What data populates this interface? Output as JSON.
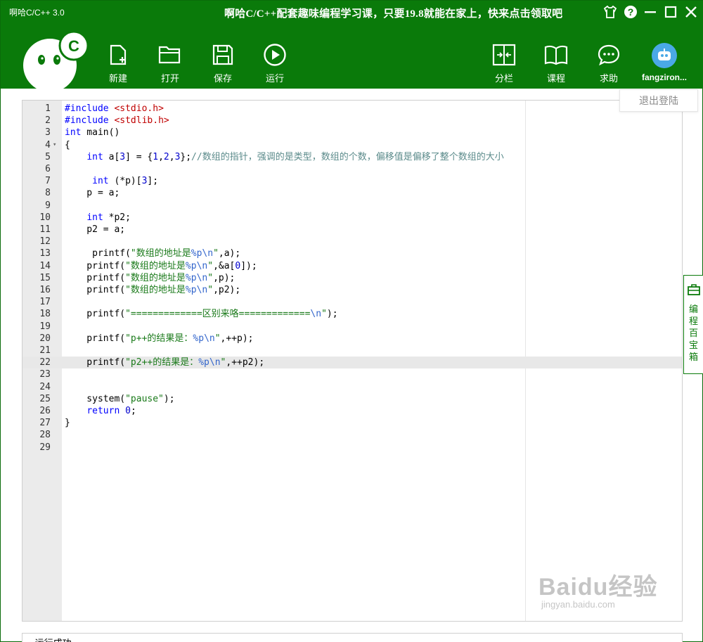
{
  "window": {
    "title": "啊哈C/C++ 3.0",
    "promo": "啊哈C/C++配套趣味编程学习课，只要19.8就能在家上，快来点击领取吧"
  },
  "toolbar": {
    "new": "新建",
    "open": "打开",
    "save": "保存",
    "run": "运行",
    "split": "分栏",
    "course": "课程",
    "help": "求助"
  },
  "user": {
    "name": "fangziron...",
    "logout": "退出登陆"
  },
  "side_panel": {
    "label": "编程百宝箱"
  },
  "editor": {
    "active_line": 22,
    "lines": [
      {
        "n": "1",
        "fold": "",
        "code": "#include <stdio.h>"
      },
      {
        "n": "2",
        "fold": "",
        "code": "#include <stdlib.h>"
      },
      {
        "n": "3",
        "fold": "",
        "code": "int main()"
      },
      {
        "n": "4",
        "fold": "▾",
        "code": "{"
      },
      {
        "n": "5",
        "fold": "",
        "code": "    int a[3] = {1,2,3};//数组的指针，强调的是类型，数组的个数，偏移值是偏移了整个数组的大小"
      },
      {
        "n": "6",
        "fold": "",
        "code": ""
      },
      {
        "n": "7",
        "fold": "",
        "code": "     int (*p)[3];"
      },
      {
        "n": "8",
        "fold": "",
        "code": "    p = a;"
      },
      {
        "n": "9",
        "fold": "",
        "code": ""
      },
      {
        "n": "10",
        "fold": "",
        "code": "    int *p2;"
      },
      {
        "n": "11",
        "fold": "",
        "code": "    p2 = a;"
      },
      {
        "n": "12",
        "fold": "",
        "code": ""
      },
      {
        "n": "13",
        "fold": "",
        "code": "     printf(\"数组的地址是%p\\n\",a);"
      },
      {
        "n": "14",
        "fold": "",
        "code": "    printf(\"数组的地址是%p\\n\",&a[0]);"
      },
      {
        "n": "15",
        "fold": "",
        "code": "    printf(\"数组的地址是%p\\n\",p);"
      },
      {
        "n": "16",
        "fold": "",
        "code": "    printf(\"数组的地址是%p\\n\",p2);"
      },
      {
        "n": "17",
        "fold": "",
        "code": ""
      },
      {
        "n": "18",
        "fold": "",
        "code": "    printf(\"=============区别来咯=============\\n\");"
      },
      {
        "n": "19",
        "fold": "",
        "code": ""
      },
      {
        "n": "20",
        "fold": "",
        "code": "    printf(\"p++的结果是：%p\\n\",++p);"
      },
      {
        "n": "21",
        "fold": "",
        "code": ""
      },
      {
        "n": "22",
        "fold": "",
        "code": "    printf(\"p2++的结果是：%p\\n\",++p2);"
      },
      {
        "n": "23",
        "fold": "",
        "code": ""
      },
      {
        "n": "24",
        "fold": "",
        "code": ""
      },
      {
        "n": "25",
        "fold": "",
        "code": "    system(\"pause\");"
      },
      {
        "n": "26",
        "fold": "",
        "code": "    return 0;"
      },
      {
        "n": "27",
        "fold": "",
        "code": "}"
      },
      {
        "n": "28",
        "fold": "",
        "code": ""
      },
      {
        "n": "29",
        "fold": "",
        "code": ""
      }
    ]
  },
  "output": {
    "text": "--运行成功--"
  },
  "watermark": {
    "main": "Baidu经验",
    "sub": "jingyan.baidu.com"
  },
  "colors": {
    "header": "#0a7a0a",
    "keyword": "#0000ff",
    "include": "#c00000",
    "string": "#1a7a1a",
    "comment": "#5b8b8b"
  }
}
